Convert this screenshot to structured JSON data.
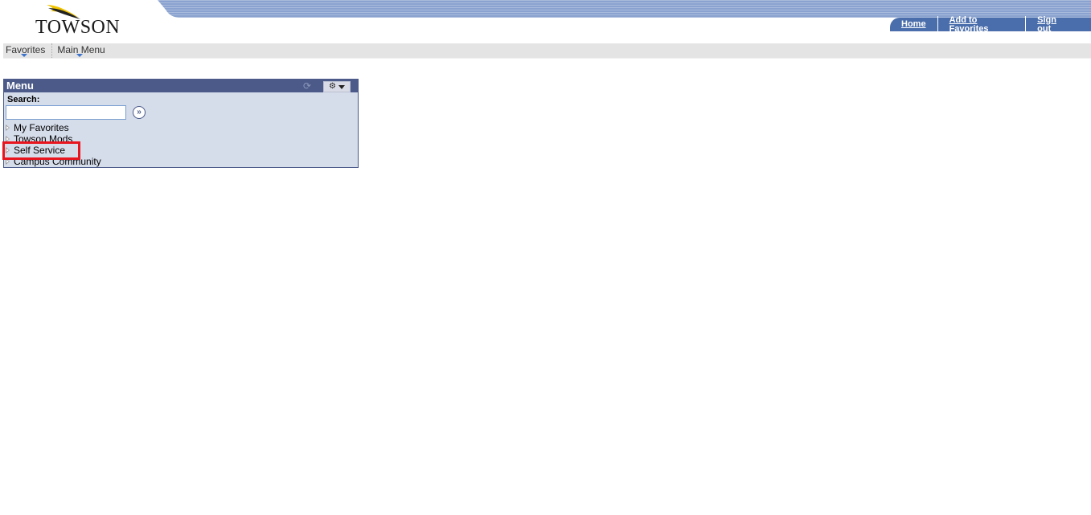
{
  "header": {
    "logo_text": "TOWSON",
    "links": [
      {
        "label": "Home"
      },
      {
        "label": "Add to Favorites"
      },
      {
        "label": "Sign out"
      }
    ],
    "accent_color": "#4a6eab"
  },
  "nav": {
    "items": [
      {
        "label": "Favorites"
      },
      {
        "label": "Main Menu"
      }
    ]
  },
  "menu_pagelet": {
    "title": "Menu",
    "search_label": "Search:",
    "search_value": "",
    "items": [
      {
        "label": "My Favorites"
      },
      {
        "label": "Towson Mods"
      },
      {
        "label": "Self Service"
      },
      {
        "label": "Campus Community"
      }
    ],
    "highlighted_item": "Self Service",
    "highlight_color": "#e8141e",
    "header_color": "#4b5a89",
    "body_color": "#d5dcea"
  }
}
